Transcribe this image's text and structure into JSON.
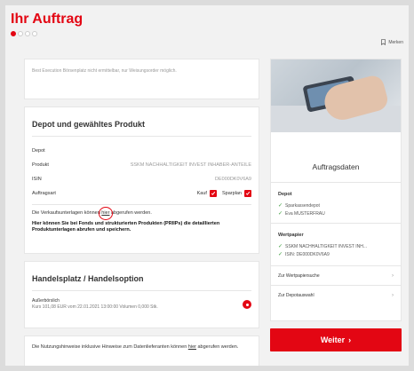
{
  "header": {
    "title": "Ihr Auftrag",
    "steps_total": 4,
    "steps_active": 1,
    "merken_label": "Merken"
  },
  "info": {
    "text": "Best Execution Börsenplatz nicht ermittelbar, nur Weisungsorder möglich."
  },
  "depot": {
    "title": "Depot und gewähltes Produkt",
    "rows": [
      {
        "label": "Depot",
        "value": ""
      },
      {
        "label": "Produkt",
        "value": "SSKM NACHHALTIGKEIT INVEST INHABER-ANTEILE"
      },
      {
        "label": "ISIN",
        "value": "DE000DK0V6A9"
      }
    ],
    "auftragsart_label": "Auftragsart",
    "kauf_label": "Kauf",
    "sparplan_label": "Sparplan",
    "text1_before": "Die Verkaufsunterlagen können ",
    "text1_link": "hier",
    "text1_after": " abgerufen werden.",
    "text2": "Hier können Sie bei Fonds und strukturierten Produkten (PRIIPs) die detaillierten Produktunterlagen abrufen und speichern."
  },
  "handel": {
    "title": "Handelsplatz / Handelsoption",
    "option_title": "Außerbörslich",
    "option_sub": "Kurs 101,08 EUR vom 22.01.2021 13:00:00 Volumen 0,000 Stk."
  },
  "note": {
    "before": "Die Nutzungshinweise inklusive Hinweise zum Datenlieferanten können ",
    "link": "hier",
    "after": " abgerufen werden."
  },
  "summary": {
    "title": "Auftragsdaten",
    "depot_heading": "Depot",
    "depot_items": [
      "Sparkassendepot",
      "Eva MUSTERFRAU"
    ],
    "wp_heading": "Wertpapier",
    "wp_items": [
      "SSKM NACHHALTIGKEIT INVEST INH...",
      "ISIN: DE000DK0V6A9"
    ],
    "link1": "Zur Wertpapiersuche",
    "link2": "Zur Depotauswahl"
  },
  "cta": {
    "label": "Weiter",
    "arrow": "›"
  },
  "colors": {
    "accent": "#e30613",
    "check": "#3a9d3a"
  }
}
